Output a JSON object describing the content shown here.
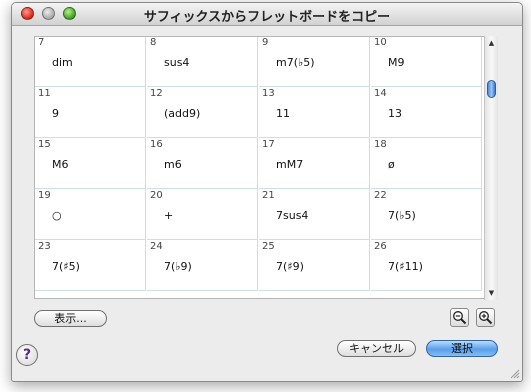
{
  "window": {
    "title": "サフィックスからフレットボードをコピー"
  },
  "grid": {
    "cells": [
      {
        "num": "7",
        "label": "dim"
      },
      {
        "num": "8",
        "label": "sus4"
      },
      {
        "num": "9",
        "label": "m7(♭5)"
      },
      {
        "num": "10",
        "label": "M9"
      },
      {
        "num": "11",
        "label": "9"
      },
      {
        "num": "12",
        "label": "(add9)"
      },
      {
        "num": "13",
        "label": "11"
      },
      {
        "num": "14",
        "label": "13"
      },
      {
        "num": "15",
        "label": "M6"
      },
      {
        "num": "16",
        "label": "m6"
      },
      {
        "num": "17",
        "label": "mM7"
      },
      {
        "num": "18",
        "label": "ø"
      },
      {
        "num": "19",
        "label": "○"
      },
      {
        "num": "20",
        "label": "+"
      },
      {
        "num": "21",
        "label": "7sus4"
      },
      {
        "num": "22",
        "label": "7(♭5)"
      },
      {
        "num": "23",
        "label": "7(♯5)"
      },
      {
        "num": "24",
        "label": "7(♭9)"
      },
      {
        "num": "25",
        "label": "7(♯9)"
      },
      {
        "num": "26",
        "label": "7(♯11)"
      }
    ]
  },
  "buttons": {
    "show": "表示...",
    "cancel": "キャンセル",
    "select": "選択",
    "help": "?"
  },
  "icons": {
    "zoom_out": "zoom-out-icon",
    "zoom_in": "zoom-in-icon"
  }
}
